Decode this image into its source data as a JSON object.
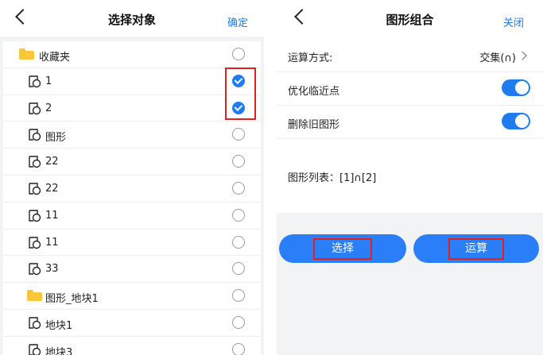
{
  "left_panel": {
    "title": "选择对象",
    "confirm": "确定",
    "items": [
      {
        "label": "收藏夹",
        "type": "folder",
        "checked": false
      },
      {
        "label": "1",
        "type": "shape",
        "checked": true
      },
      {
        "label": "2",
        "type": "shape",
        "checked": true
      },
      {
        "label": "图形",
        "type": "shape",
        "checked": false
      },
      {
        "label": "22",
        "type": "shape",
        "checked": false
      },
      {
        "label": "22",
        "type": "shape",
        "checked": false
      },
      {
        "label": "11",
        "type": "shape",
        "checked": false
      },
      {
        "label": "11",
        "type": "shape",
        "checked": false
      },
      {
        "label": "33",
        "type": "shape",
        "checked": false
      },
      {
        "label": "图形_地块1",
        "type": "folder",
        "checked": false
      },
      {
        "label": "地块1",
        "type": "shape",
        "checked": false
      },
      {
        "label": "地块3",
        "type": "shape",
        "checked": false
      }
    ]
  },
  "right_panel": {
    "title": "图形组合",
    "close": "关闭",
    "operation_label": "运算方式:",
    "operation_value": "交集(∩)",
    "optimize_label": "优化临近点",
    "optimize_on": true,
    "delete_label": "删除旧图形",
    "delete_on": true,
    "shape_list": "图形列表：[1]∩[2]",
    "select_button": "选择",
    "compute_button": "运算"
  },
  "colors": {
    "accent": "#1e7cf0",
    "button": "#2a7ef8",
    "highlight": "#e0221f",
    "folder": "#fbc638"
  }
}
